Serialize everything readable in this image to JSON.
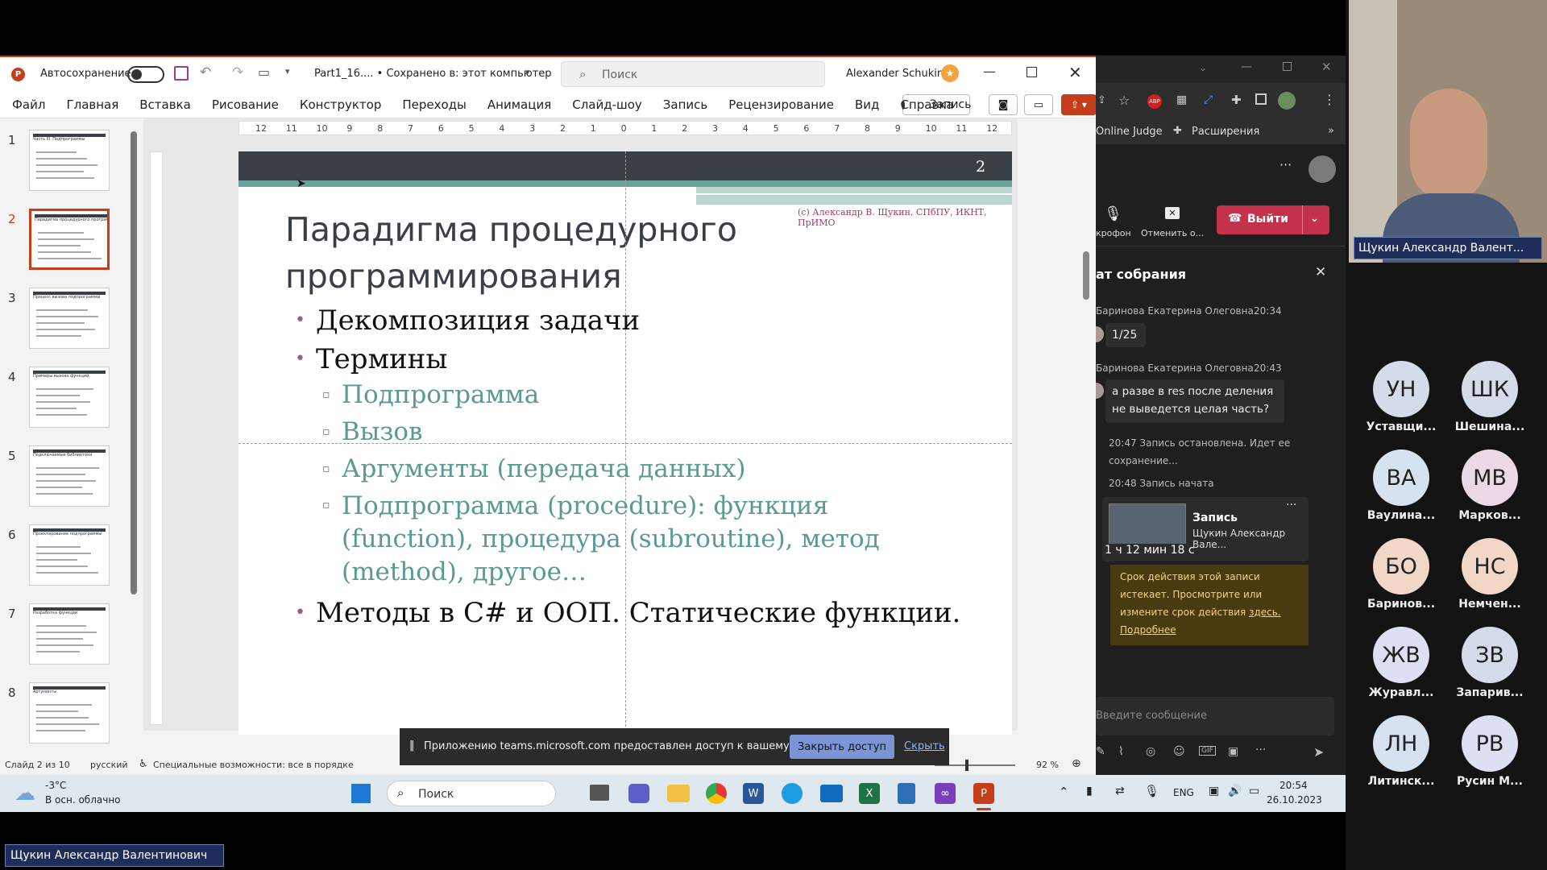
{
  "ppt": {
    "autosave_label": "Автосохранение",
    "doc_title": "Part1_16.... • Сохранено в: этот компьютер",
    "search_placeholder": "Поиск",
    "user_name": "Alexander Schukin",
    "menu": [
      "Файл",
      "Главная",
      "Вставка",
      "Рисование",
      "Конструктор",
      "Переходы",
      "Анимация",
      "Слайд-шоу",
      "Запись",
      "Рецензирование",
      "Вид",
      "Справка"
    ],
    "record_label": "Запись",
    "ruler": [
      "12",
      "11",
      "10",
      "9",
      "8",
      "7",
      "6",
      "5",
      "4",
      "3",
      "2",
      "1",
      "0",
      "1",
      "2",
      "3",
      "4",
      "5",
      "6",
      "7",
      "8",
      "9",
      "10",
      "11",
      "12"
    ],
    "thumbnails": [
      {
        "num": "1",
        "text": "Часть III. Подпрограммы"
      },
      {
        "num": "2",
        "text": "Парадигма процедурного программирования"
      },
      {
        "num": "3",
        "text": "Процесс вызова подпрограммы"
      },
      {
        "num": "4",
        "text": "Примеры вызова функций"
      },
      {
        "num": "5",
        "text": "Подключаемые библиотеки"
      },
      {
        "num": "6",
        "text": "Проектирование подпрограммы"
      },
      {
        "num": "7",
        "text": "Разработка функции"
      },
      {
        "num": "8",
        "text": "Аргументы"
      }
    ],
    "slide": {
      "number": "2",
      "copyright": "(с) Александр В. Щукин, СПбПУ, ИКНТ, ПрИМО",
      "title_line1": "Парадигма процедурного",
      "title_line2": "программирования",
      "b1": "Декомпозиция задачи",
      "b2": "Термины",
      "s1": "Подпрограмма",
      "s2": "Вызов",
      "s3": "Аргументы (передача данных)",
      "s4_l1": "Подпрограмма (procedure): функция",
      "s4_l2": "(function), процедура (subroutine), метод",
      "s4_l3": "(method), другое…",
      "b3": "Методы в C# и ООП. Статические функции."
    },
    "status": {
      "slide_of": "Слайд 2 из 10",
      "lang": "русский",
      "access": "Специальные возможности: все в порядке",
      "zoom": "92 %"
    },
    "share_bar": {
      "text": "Приложению teams.microsoft.com предоставлен доступ к вашему экрану.",
      "stop_button": "Закрыть доступ",
      "hide_link": "Скрыть"
    }
  },
  "browser": {
    "bookmark1": "Online Judge",
    "bookmark2": "Расширения"
  },
  "teams": {
    "mic_label": "крофон",
    "cancel_label": "Отменить о...",
    "leave_label": "Выйти",
    "chat_title": "ат собрания",
    "messages": [
      {
        "author": "Баринова Екатерина Олеговна",
        "time": "20:34",
        "text": "1/25"
      },
      {
        "author": "Баринова Екатерина Олеговна",
        "time": "20:43",
        "text_l1": "а разве в res после деления",
        "text_l2": "не выведется целая часть?"
      }
    ],
    "sys1_l1": "20:47   Запись остановлена. Идет ее",
    "sys1_l2": "сохранение...",
    "sys2": "20:48   Запись начата",
    "rec_title": "Запись",
    "rec_author": "Щукин Александр Вале...",
    "rec_duration": "1 ч 12 мин 18 с",
    "expire_l1": "Срок действия этой записи",
    "expire_l2": "истекает. Просмотрите или",
    "expire_l3": "измените срок действия",
    "expire_link": "здесь.",
    "expire_more": "Подробнее",
    "input_placeholder": "Введите сообщение"
  },
  "participants": {
    "presenter_name": "Щукин Александр Валент...",
    "people": [
      {
        "initials": "УН",
        "name": "Уставщи...",
        "color": "#d3dce8"
      },
      {
        "initials": "ШК",
        "name": "Шешина...",
        "color": "#d3dce8"
      },
      {
        "initials": "ВА",
        "name": "Ваулина...",
        "color": "#d6e2f0"
      },
      {
        "initials": "МВ",
        "name": "Марков...",
        "color": "#ecd9e8"
      },
      {
        "initials": "БО",
        "name": "Баринов...",
        "color": "#f2d7c8"
      },
      {
        "initials": "НС",
        "name": "Немчен...",
        "color": "#f2d7c8"
      },
      {
        "initials": "ЖВ",
        "name": "Журавл...",
        "color": "#dce0f2"
      },
      {
        "initials": "ЗВ",
        "name": "Запарив...",
        "color": "#d3dce8"
      },
      {
        "initials": "ЛН",
        "name": "Литинск...",
        "color": "#d6e2f0"
      },
      {
        "initials": "РВ",
        "name": "Русин М...",
        "color": "#dce0f2"
      }
    ]
  },
  "taskbar": {
    "temp": "-3°C",
    "weather": "В осн. облачно",
    "search": "Поиск",
    "lang": "ENG",
    "time": "20:54",
    "date": "26.10.2023"
  },
  "bottom_name": "Щукин Александр Валентинович"
}
